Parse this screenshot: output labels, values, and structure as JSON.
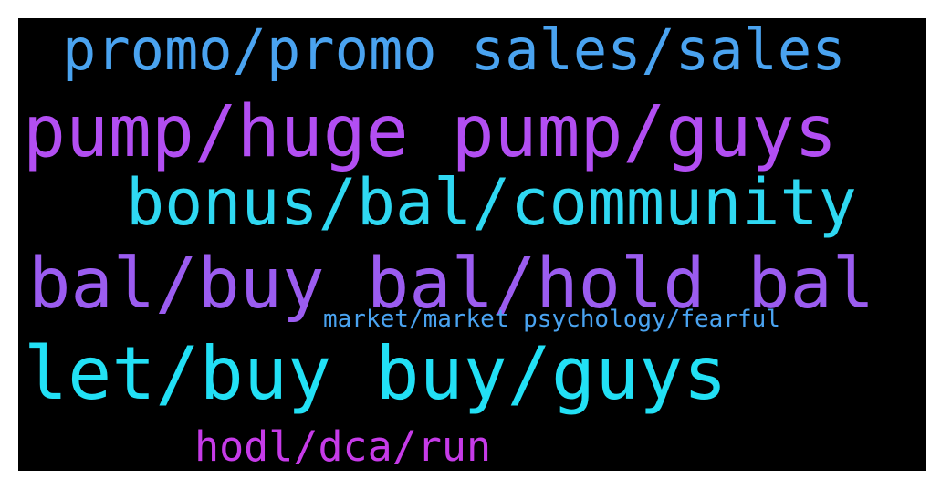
{
  "wordcloud": {
    "background": "#000000",
    "words": [
      {
        "text": "promo/promo sales/sales",
        "color": "#4aa3f0"
      },
      {
        "text": "pump/huge pump/guys",
        "color": "#b24ef2"
      },
      {
        "text": "bonus/bal/community",
        "color": "#2fd8f2"
      },
      {
        "text": "bal/buy bal/hold bal",
        "color": "#9b5cf0"
      },
      {
        "text": "market/market psychology/fearful",
        "color": "#4aa3f0"
      },
      {
        "text": "let/buy buy/guys",
        "color": "#22e0f5"
      },
      {
        "text": "hodl/dca/run",
        "color": "#c63be8"
      }
    ]
  }
}
